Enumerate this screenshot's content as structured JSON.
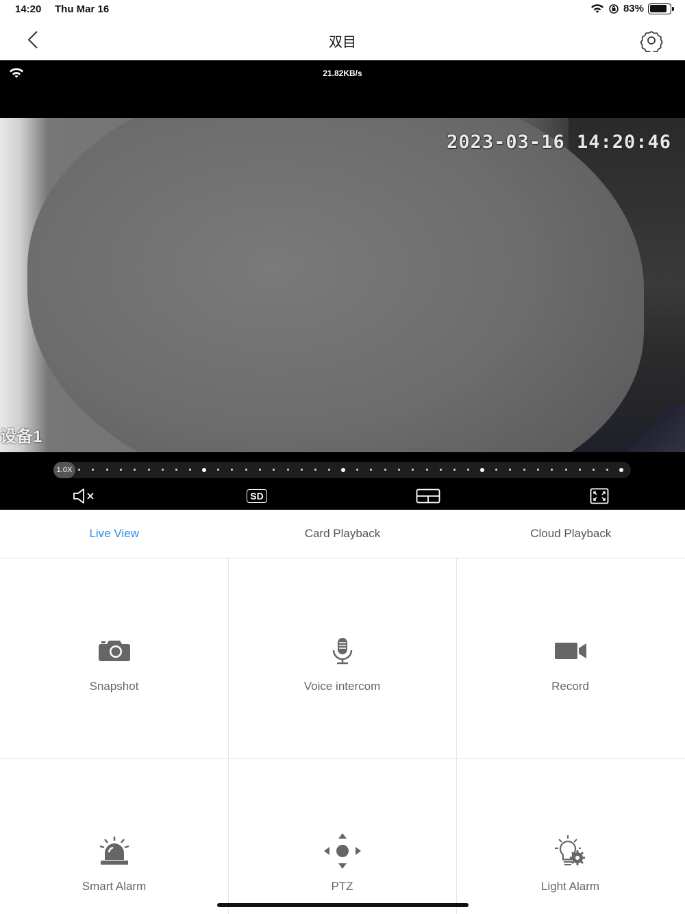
{
  "status_bar": {
    "time": "14:20",
    "date": "Thu Mar 16",
    "battery_percent": "83%",
    "battery_level": 0.83
  },
  "nav": {
    "title": "双目"
  },
  "video": {
    "bitrate": "21.82KB/s",
    "timestamp": "2023-03-16  14:20:46",
    "device_label": "设备1",
    "zoom_level": "1.0X"
  },
  "tabs": [
    {
      "label": "Live View",
      "active": true
    },
    {
      "label": "Card Playback",
      "active": false
    },
    {
      "label": "Cloud Playback",
      "active": false
    }
  ],
  "actions": {
    "snapshot": "Snapshot",
    "voice_intercom": "Voice intercom",
    "record": "Record",
    "smart_alarm": "Smart Alarm",
    "ptz": "PTZ",
    "light_alarm": "Light Alarm"
  },
  "colors": {
    "accent": "#2d8ae6",
    "icon_gray": "#666666",
    "label_gray": "#666666"
  }
}
